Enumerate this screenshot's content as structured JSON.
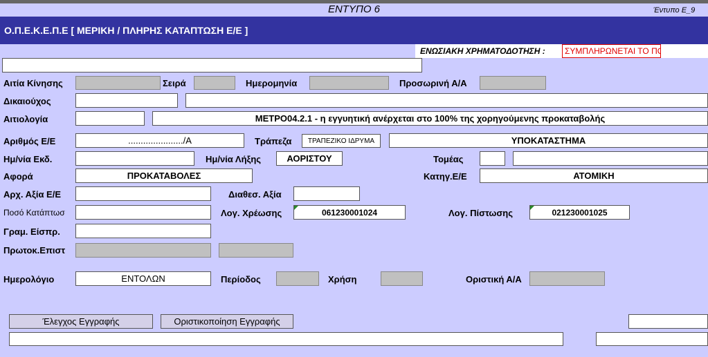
{
  "top": {
    "form_title": "ΕΝΤΥΠΟ 6",
    "form_code": "Έντυπο Ε_9"
  },
  "banner": {
    "title": "Ο.Π.Ε.Κ.Ε.Π.Ε [ ΜΕΡΙΚΗ / ΠΛΗΡΗΣ ΚΑΤΑΠΤΩΣΗ Ε/Ε ]"
  },
  "eu_funding": {
    "label": "ΕΝΩΣΙΑΚΗ ΧΡΗΜΑΤΟΔΟΤΗΣΗ :",
    "value": "ΣΥΜΠΛΗΡΩΝΕΤΑΙ ΤΟ ΠΟΣΟΣΤΟ"
  },
  "labels": {
    "cause": "Αιτία Κίνησης",
    "series": "Σειρά",
    "date": "Ημερομηνία",
    "temp_aa": "Προσωρινή Α/Α",
    "beneficiary": "Δικαιούχος",
    "justification": "Αιτιολογία",
    "lg_number": "Αριθμός Ε/Ε",
    "bank": "Τράπεζα",
    "issue_date": "Ημ/νία Εκδ.",
    "expiry_date": "Ημ/νία Λήξης",
    "sector": "Τομέας",
    "subject": "Αφορά",
    "lg_category": "Κατηγ.Ε/Ε",
    "initial_value": "Αρχ. Αξία Ε/Ε",
    "available_value": "Διαθεσ. Αξία",
    "forfeit_amount": "Ποσό Κατάπτωσ",
    "debit_account": "Λογ. Χρέωσης",
    "credit_account": "Λογ. Πίστωσης",
    "receipt_line": "Γραμ. Είσπρ.",
    "protocol": "Πρωτοκ.Επιστ",
    "journal": "Ημερολόγιο",
    "period": "Περίοδος",
    "use": "Χρήση",
    "final_aa": "Οριστική Α/Α"
  },
  "values": {
    "justification_text": "ΜΕΤΡΟ04.2.1 - η εγγυητική ανέρχεται στο 100% της χορηγούμενης προκαταβολής",
    "lg_number": "....................../Α",
    "bank_type": "ΤΡΑΠΕΖΙΚΟ ΙΔΡΥΜΑ",
    "branch": "ΥΠΟΚΑΤΑΣΤΗΜΑ",
    "expiry": "ΑΟΡΙΣΤΟΥ",
    "subject": "ΠΡΟΚΑΤΑΒΟΛΕΣ",
    "category": "ΑΤΟΜΙΚΗ",
    "debit_account": "061230001024",
    "credit_account": "021230001025",
    "journal": "ΕΝΤΟΛΩΝ"
  },
  "buttons": {
    "check": "Έλεγχος Εγγραφής",
    "finalize": "Οριστικοποίηση Εγγραφής"
  }
}
